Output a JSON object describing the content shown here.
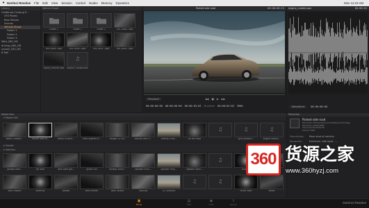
{
  "menubar": {
    "apple_icon": "apple-icon",
    "app_name": "DaVinci Resolve",
    "items": [
      "File",
      "Edit",
      "View",
      "Session",
      "Control",
      "Nodes",
      "Memory",
      "Dynamics"
    ],
    "clock": "Mon 11:23 AM"
  },
  "library": {
    "header": "Library",
    "items": [
      {
        "label": "California Cruising P...",
        "selected": false
      },
      {
        "label": "VFX Plates",
        "selected": false
      },
      {
        "label": "Raw Shoots",
        "selected": false
      },
      {
        "label": "Scenes",
        "selected": false
      },
      {
        "label": "Vehicle Shoot",
        "selected": true
      },
      {
        "label": "Folder 1",
        "selected": false
      },
      {
        "label": "Folder 2",
        "selected": false
      },
      {
        "label": "Folder 3",
        "selected": false
      },
      {
        "label": "Wed_280_HD",
        "selected": false
      },
      {
        "label": "driving_080_HD",
        "selected": false
      },
      {
        "label": "sunset_020_HD",
        "selected": false
      },
      {
        "label": "B Roll",
        "selected": false
      }
    ]
  },
  "browser": {
    "path": "Vehicle Shoot",
    "clips": [
      {
        "label": "Folder 1",
        "kind": "folder"
      },
      {
        "label": "Folder 2",
        "kind": "folder"
      },
      {
        "label": "Folder 3",
        "kind": "folder"
      },
      {
        "label": "091-0088...dpx",
        "kind": "video"
      },
      {
        "label": "091-0089...dpx",
        "kind": "video"
      },
      {
        "label": "091-0090...dpx",
        "kind": "video"
      },
      {
        "label": "091-0091...dpx",
        "kind": "video"
      },
      {
        "label": "091-0092...dpx",
        "kind": "video"
      },
      {
        "label": "Sound_kitchen.wav",
        "kind": "audio"
      },
      {
        "label": "engine_rumble.wav",
        "kind": "audio"
      }
    ]
  },
  "viewer": {
    "title": "Parked side road",
    "timecode": "00:00:00:15",
    "mode": "Playback",
    "tc_in": "00:00:00:00",
    "tc_src": "00:00:00:00",
    "tc_dur": "00:00:03:03",
    "duration_label": "Duration",
    "duration": "00:00:03:03",
    "frames": "3900",
    "transport": {
      "rewind": "◀◀",
      "stop": "■",
      "play": "▶",
      "forward": "▶▶"
    }
  },
  "audio": {
    "title": "engine_rumble.wav",
    "timecode": "00:00:03",
    "mode": "Waveform",
    "tc": "00:00:00:00"
  },
  "media_pool": {
    "header": "Media Pool",
    "bin1": "Master Bin",
    "bin2": "Sunset",
    "bin3": "Interiors",
    "row1": [
      "beach custom...",
      "Parked side ro...",
      "beach cruisin...",
      "front quarter a...",
      "badge CU 001",
      "bonnet cam 0...",
      "interior cruis...",
      "on the road",
      "",
      "tyre_noise00...",
      "engine noise3..."
    ],
    "row2": [
      "garage door...",
      "car door",
      "dark steel gar...",
      "guard cus",
      "hallway slidin...",
      "speaker insul...",
      "speaker man...",
      "speaker dash...",
      "",
      "buttons",
      "speaker grill"
    ],
    "row3": [
      "start engine",
      "steering",
      "pedals",
      "wind screen",
      "door handle",
      "braking",
      "A-C buttons",
      "",
      "",
      "driver seat",
      "detail"
    ]
  },
  "metadata": {
    "header": "Metadata",
    "clip_title": "Parked side road",
    "lines": [
      "Macintosh HD/Users/Documents/Resolve/Footage",
      "Resolution 1920x1080",
      "Timecode 00:00:00:00",
      "Frames 3900"
    ],
    "description_label": "Description",
    "description": "Rear shot of vehicle",
    "keywords_label": "Keywords",
    "keywords": "Exteriors, late light, ..."
  },
  "pages": {
    "items": [
      "Media",
      "Edit",
      "Color",
      "Deliver"
    ],
    "active": "Media"
  },
  "footer": {
    "product": "DaVinci Resolve"
  },
  "watermark": {
    "logo_number": "360",
    "text": "货源之家",
    "url": "www.360hyzj.com"
  },
  "colors": {
    "accent": "#ff8c1a",
    "panel": "#232325",
    "background": "#1b1b1c",
    "watermark_red": "#d7261f"
  }
}
